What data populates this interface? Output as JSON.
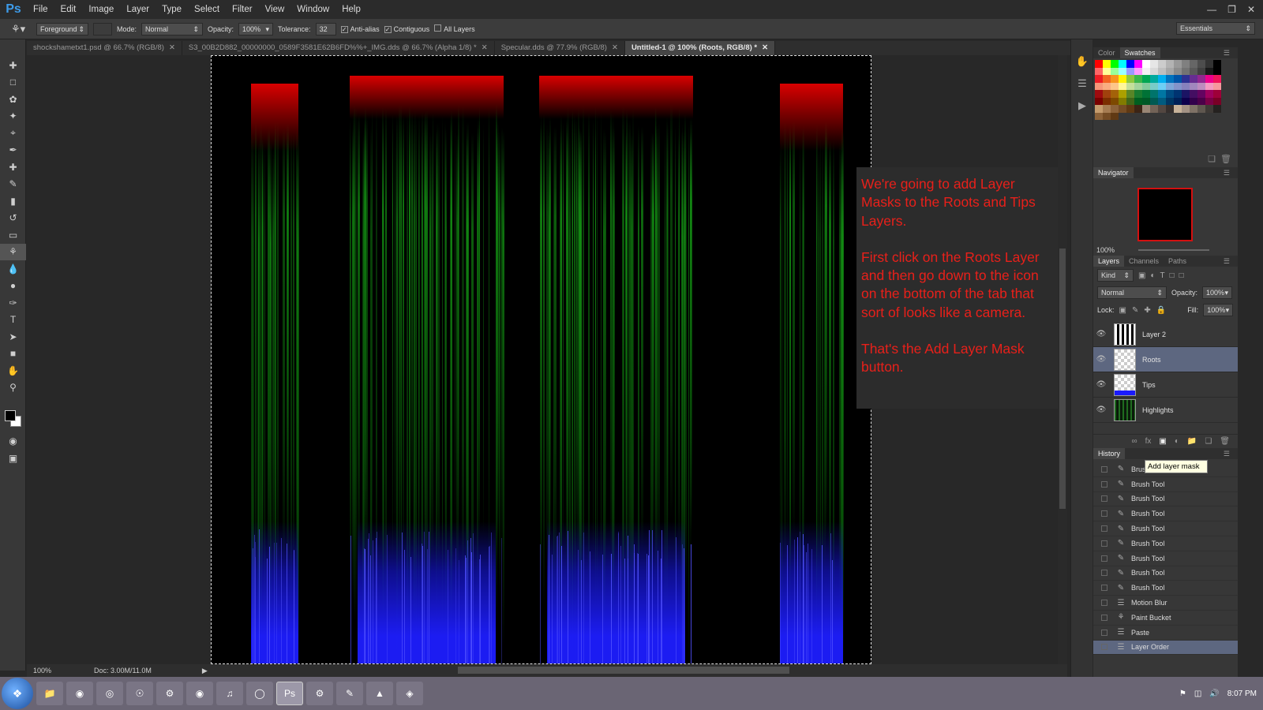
{
  "menubar": {
    "logo": "Ps",
    "items": [
      "File",
      "Edit",
      "Image",
      "Layer",
      "Type",
      "Select",
      "Filter",
      "View",
      "Window",
      "Help"
    ]
  },
  "options": {
    "fill_source": "Foreground",
    "mode_label": "Mode:",
    "mode_value": "Normal",
    "opacity_label": "Opacity:",
    "opacity_value": "100%",
    "tolerance_label": "Tolerance:",
    "tolerance_value": "32",
    "antialias_label": "Anti-alias",
    "contiguous_label": "Contiguous",
    "all_layers_label": "All Layers",
    "workspace": "Essentials"
  },
  "tabs": [
    {
      "label": "shockshametxt1.psd @ 66.7% (RGB/8)"
    },
    {
      "label": "S3_00B2D882_00000000_0589F3581E62B6FD%%+_IMG.dds @ 66.7% (Alpha 1/8) *"
    },
    {
      "label": "Specular.dds @ 77.9% (RGB/8)"
    },
    {
      "label": "Untitled-1 @ 100% (Roots, RGB/8) *"
    }
  ],
  "callout": {
    "p1": "We're going to add Layer Masks to the Roots and Tips Layers.",
    "p2": "First click on the Roots Layer and then go down to the icon on the bottom of the tab that sort of looks like a camera.",
    "p3": "That's the Add Layer Mask button."
  },
  "status": {
    "zoom": "100%",
    "doc": "Doc: 3.00M/11.0M"
  },
  "color_panel": {
    "tab_color": "Color",
    "tab_swatches": "Swatches",
    "swatches": [
      "#ff0000",
      "#ffff00",
      "#00ff00",
      "#00ffff",
      "#0000ff",
      "#ff00ff",
      "#ffffff",
      "#e6e6e6",
      "#cccccc",
      "#b3b3b3",
      "#999999",
      "#808080",
      "#666666",
      "#4d4d4d",
      "#333333",
      "#000000",
      "#ff6666",
      "#ffff99",
      "#99ff99",
      "#99ffff",
      "#9999ff",
      "#ff99ff",
      "#f2f2f2",
      "#d9d9d9",
      "#bfbfbf",
      "#a6a6a6",
      "#8c8c8c",
      "#737373",
      "#595959",
      "#404040",
      "#1a1a1a",
      "#000000",
      "#ed1c24",
      "#f26522",
      "#f7941d",
      "#fff200",
      "#8dc63f",
      "#39b54a",
      "#00a651",
      "#00a99d",
      "#00aeef",
      "#0072bc",
      "#0054a6",
      "#2e3192",
      "#662d91",
      "#92278f",
      "#ec008c",
      "#ed145b",
      "#f69679",
      "#f9ad81",
      "#fdc689",
      "#fff799",
      "#c4df9b",
      "#a3d39c",
      "#82ca9c",
      "#7accc8",
      "#6dcff6",
      "#7da7d9",
      "#8393ca",
      "#8781bd",
      "#a187be",
      "#bd8cbf",
      "#f49ac2",
      "#f6989d",
      "#9e0b0f",
      "#a0410d",
      "#a36209",
      "#aba000",
      "#598527",
      "#197b30",
      "#007236",
      "#00746b",
      "#0076a3",
      "#004a80",
      "#003471",
      "#1b1464",
      "#440e62",
      "#630460",
      "#9e005d",
      "#9e0039",
      "#790000",
      "#7b2e00",
      "#7d4900",
      "#827b00",
      "#406618",
      "#005e20",
      "#005826",
      "#005952",
      "#005b7f",
      "#003663",
      "#002157",
      "#0d004c",
      "#32004b",
      "#4b0049",
      "#7b0046",
      "#7a0026",
      "#c69c6d",
      "#a67c52",
      "#8c6239",
      "#754c24",
      "#603913",
      "#3c2415",
      "#998675",
      "#736357",
      "#534741",
      "#362f2d",
      "#c7b299",
      "#a39284",
      "#7f7266",
      "#5f574f",
      "#3f3a36",
      "#252220",
      "#8c6239",
      "#754c24",
      "#603913"
    ],
    "navigator_title": "Navigator",
    "navigator_zoom": "100%"
  },
  "layers_panel": {
    "tabs": [
      "Layers",
      "Channels",
      "Paths"
    ],
    "kind": "Kind",
    "blend": "Normal",
    "opacity_label": "Opacity:",
    "opacity": "100%",
    "lock_label": "Lock:",
    "fill_label": "Fill:",
    "fill": "100%",
    "layers": [
      {
        "name": "Layer 2"
      },
      {
        "name": "Roots"
      },
      {
        "name": "Tips"
      },
      {
        "name": "Highlights"
      }
    ],
    "tooltip": "Add layer mask"
  },
  "history_panel": {
    "title": "History",
    "items": [
      "Brush Tool",
      "Brush Tool",
      "Brush Tool",
      "Brush Tool",
      "Brush Tool",
      "Brush Tool",
      "Brush Tool",
      "Brush Tool",
      "Brush Tool",
      "Motion Blur",
      "Paint Bucket",
      "Paste",
      "Layer Order"
    ]
  },
  "taskbar": {
    "time": "8:07 PM"
  }
}
